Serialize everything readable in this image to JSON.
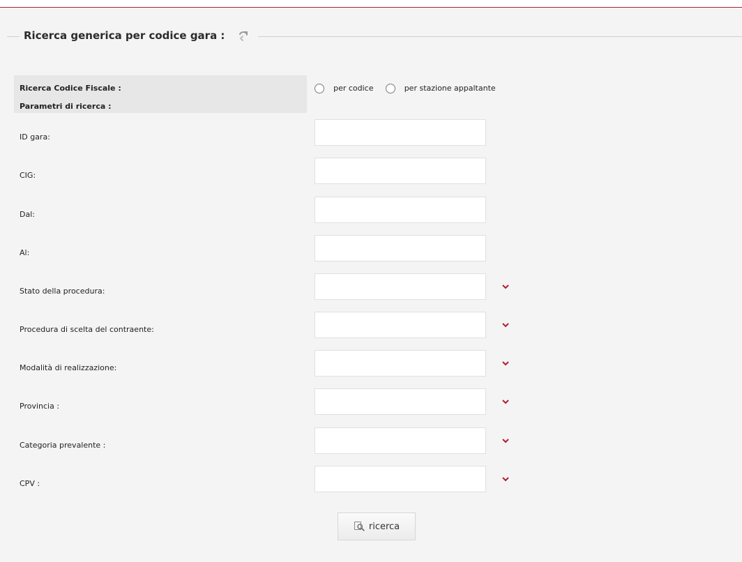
{
  "section": {
    "title": "Ricerca generica per codice gara :"
  },
  "search_mode": {
    "label": "Ricerca Codice Fiscale :",
    "params_label": "Parametri di ricerca :",
    "options": [
      "per codice",
      "per stazione appaltante"
    ]
  },
  "fields": [
    {
      "label": "ID gara:"
    },
    {
      "label": "CIG:"
    },
    {
      "label": "Dal:"
    },
    {
      "label": "Al:"
    }
  ],
  "selects": [
    {
      "label": "Stato della procedura:"
    },
    {
      "label": "Procedura di scelta del contraente:"
    },
    {
      "label": "Modalità di realizzazione:"
    },
    {
      "label": "Provincia :"
    },
    {
      "label": "Categoria prevalente :"
    },
    {
      "label": "CPV :"
    }
  ],
  "actions": {
    "search_label": "ricerca"
  },
  "colors": {
    "accent_red": "#b01c2e",
    "background": "#f4f4f4"
  }
}
